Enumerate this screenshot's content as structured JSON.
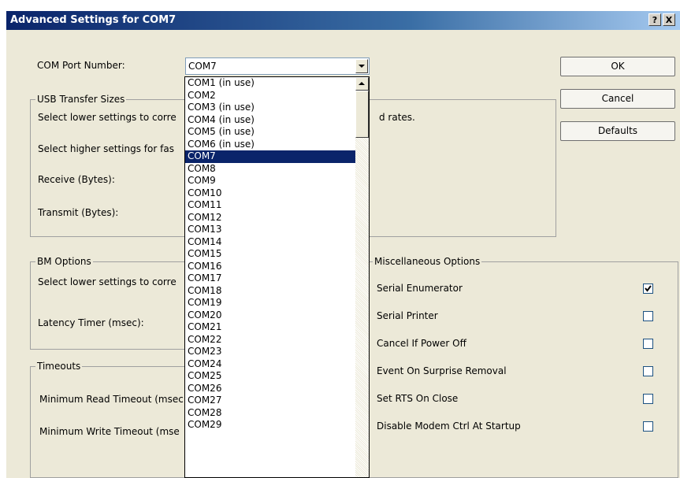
{
  "window": {
    "title": "Advanced Settings for COM7",
    "help_glyph": "?",
    "close_glyph": "X"
  },
  "com_port": {
    "label": "COM Port Number:",
    "value": "COM7",
    "options": [
      "COM1 (in use)",
      "COM2",
      "COM3 (in use)",
      "COM4 (in use)",
      "COM5 (in use)",
      "COM6 (in use)",
      "COM7",
      "COM8",
      "COM9",
      "COM10",
      "COM11",
      "COM12",
      "COM13",
      "COM14",
      "COM15",
      "COM16",
      "COM17",
      "COM18",
      "COM19",
      "COM20",
      "COM21",
      "COM22",
      "COM23",
      "COM24",
      "COM25",
      "COM26",
      "COM27",
      "COM28",
      "COM29"
    ],
    "selected_index": 6
  },
  "buttons": {
    "ok": "OK",
    "cancel": "Cancel",
    "defaults": "Defaults"
  },
  "usb": {
    "legend": "USB Transfer Sizes",
    "lower_text": "Select lower settings to corre",
    "lower_text_tail": "d rates.",
    "higher_text": "Select higher settings for fas",
    "receive_label": "Receive (Bytes):",
    "transmit_label": "Transmit (Bytes):"
  },
  "bm": {
    "legend": "BM Options",
    "lower_text": "Select lower settings to corre",
    "latency_label": "Latency Timer (msec):"
  },
  "timeouts": {
    "legend": "Timeouts",
    "read_label": "Minimum Read Timeout (msec",
    "write_label": "Minimum Write Timeout (mse"
  },
  "misc": {
    "legend": "Miscellaneous Options",
    "options": [
      {
        "label": "Serial Enumerator",
        "checked": true
      },
      {
        "label": "Serial Printer",
        "checked": false
      },
      {
        "label": "Cancel If Power Off",
        "checked": false
      },
      {
        "label": "Event On Surprise Removal",
        "checked": false
      },
      {
        "label": "Set RTS On Close",
        "checked": false
      },
      {
        "label": "Disable Modem Ctrl At Startup",
        "checked": false
      }
    ]
  },
  "icons": {
    "combo_arrow": "chevron-down-icon",
    "scroll_up": "chevron-up-icon",
    "check": "check-icon"
  }
}
